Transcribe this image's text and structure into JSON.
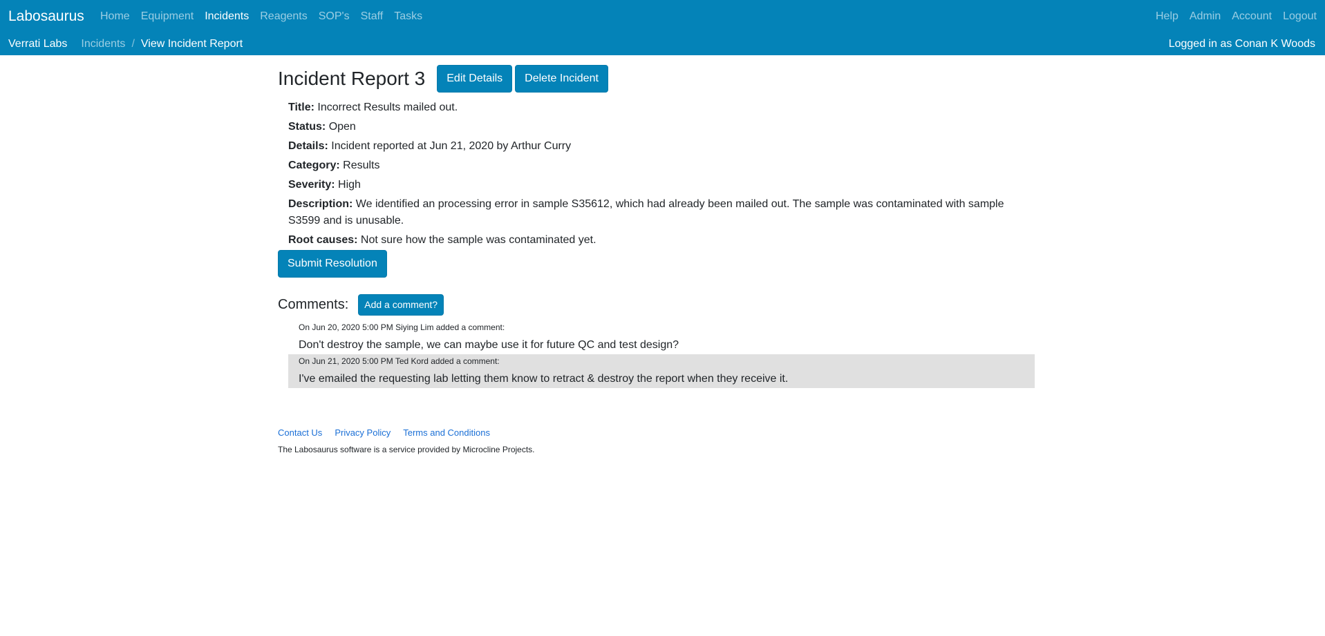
{
  "app": {
    "brand": "Labosaurus"
  },
  "nav": {
    "left": [
      {
        "label": "Home",
        "active": false
      },
      {
        "label": "Equipment",
        "active": false
      },
      {
        "label": "Incidents",
        "active": true
      },
      {
        "label": "Reagents",
        "active": false
      },
      {
        "label": "SOP's",
        "active": false
      },
      {
        "label": "Staff",
        "active": false
      },
      {
        "label": "Tasks",
        "active": false
      }
    ],
    "right": [
      {
        "label": "Help"
      },
      {
        "label": "Admin"
      },
      {
        "label": "Account"
      },
      {
        "label": "Logout"
      }
    ]
  },
  "breadcrumb": {
    "org": "Verrati Labs",
    "section": "Incidents",
    "current": "View Incident Report"
  },
  "login_status": "Logged in as Conan K Woods",
  "incident": {
    "title": "Incident Report 3",
    "edit_label": "Edit Details",
    "delete_label": "Delete Incident",
    "fields": [
      {
        "label": "Title:",
        "value": "Incorrect Results mailed out."
      },
      {
        "label": "Status:",
        "value": "Open"
      },
      {
        "label": "Details:",
        "value": "Incident reported at Jun 21, 2020 by Arthur Curry"
      },
      {
        "label": "Category:",
        "value": "Results"
      },
      {
        "label": "Severity:",
        "value": "High"
      },
      {
        "label": "Description:",
        "value": "We identified an processing error in sample S35612, which had already been mailed out. The sample was contaminated with sample S3599 and is unusable."
      },
      {
        "label": "Root causes:",
        "value": "Not sure how the sample was contaminated yet."
      }
    ],
    "submit_label": "Submit Resolution"
  },
  "comments": {
    "title": "Comments:",
    "add_label": "Add a comment?",
    "items": [
      {
        "meta": "On Jun 20, 2020 5:00 PM Siying Lim added a comment:",
        "text": "Don't destroy the sample, we can maybe use it for future QC and test design?"
      },
      {
        "meta": "On Jun 21, 2020 5:00 PM Ted Kord added a comment:",
        "text": "I've emailed the requesting lab letting them know to retract & destroy the report when they receive it."
      }
    ]
  },
  "footer": {
    "links": [
      "Contact Us",
      "Privacy Policy",
      "Terms and Conditions"
    ],
    "text": "The Labosaurus software is a service provided by Microcline Projects."
  },
  "colors": {
    "accent": "#0483b8",
    "comment_alt_bg": "#e0e0e0",
    "footer_link": "#1a6fd6"
  }
}
